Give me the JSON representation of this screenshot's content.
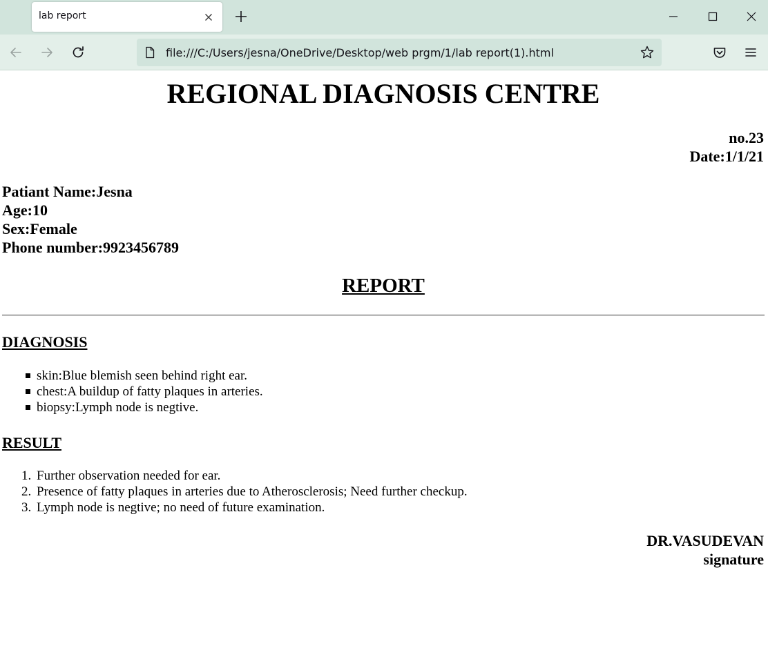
{
  "browser": {
    "tab_title": "lab report",
    "url": "file:///C:/Users/jesna/OneDrive/Desktop/web prgm/1/lab report(1).html",
    "icons": {
      "tab_close": "close-icon",
      "new_tab": "plus-icon",
      "minimize": "minimize-icon",
      "maximize": "maximize-icon",
      "close_window": "close-window-icon",
      "back": "back-arrow-icon",
      "forward": "forward-arrow-icon",
      "reload": "reload-icon",
      "page": "page-icon",
      "bookmark": "star-icon",
      "pocket": "pocket-icon",
      "menu": "hamburger-menu-icon"
    },
    "colors": {
      "tabstrip": "#d1e4dc",
      "navbar": "#e3efe9",
      "urlbar": "#d1e4dc"
    }
  },
  "page": {
    "title": "REGIONAL DIAGNOSIS CENTRE",
    "report_no": "no.23",
    "date": "Date:1/1/21",
    "patient": {
      "name": "Patiant Name:Jesna",
      "age": "Age:10",
      "sex": "Sex:Female",
      "phone": "Phone number:9923456789"
    },
    "report_heading": "REPORT",
    "diagnosis": {
      "heading": "DIAGNOSIS",
      "items": [
        "skin:Blue blemish seen behind right ear.",
        "chest:A buildup of fatty plaques in arteries.",
        "biopsy:Lymph node is negtive."
      ]
    },
    "result": {
      "heading": "RESULT",
      "items": [
        "Further observation needed for ear.",
        "Presence of fatty plaques in arteries due to Atherosclerosis; Need further checkup.",
        "Lymph node is negtive; no need of future examination."
      ]
    },
    "doctor": "DR.VASUDEVAN",
    "signature": "signature"
  }
}
